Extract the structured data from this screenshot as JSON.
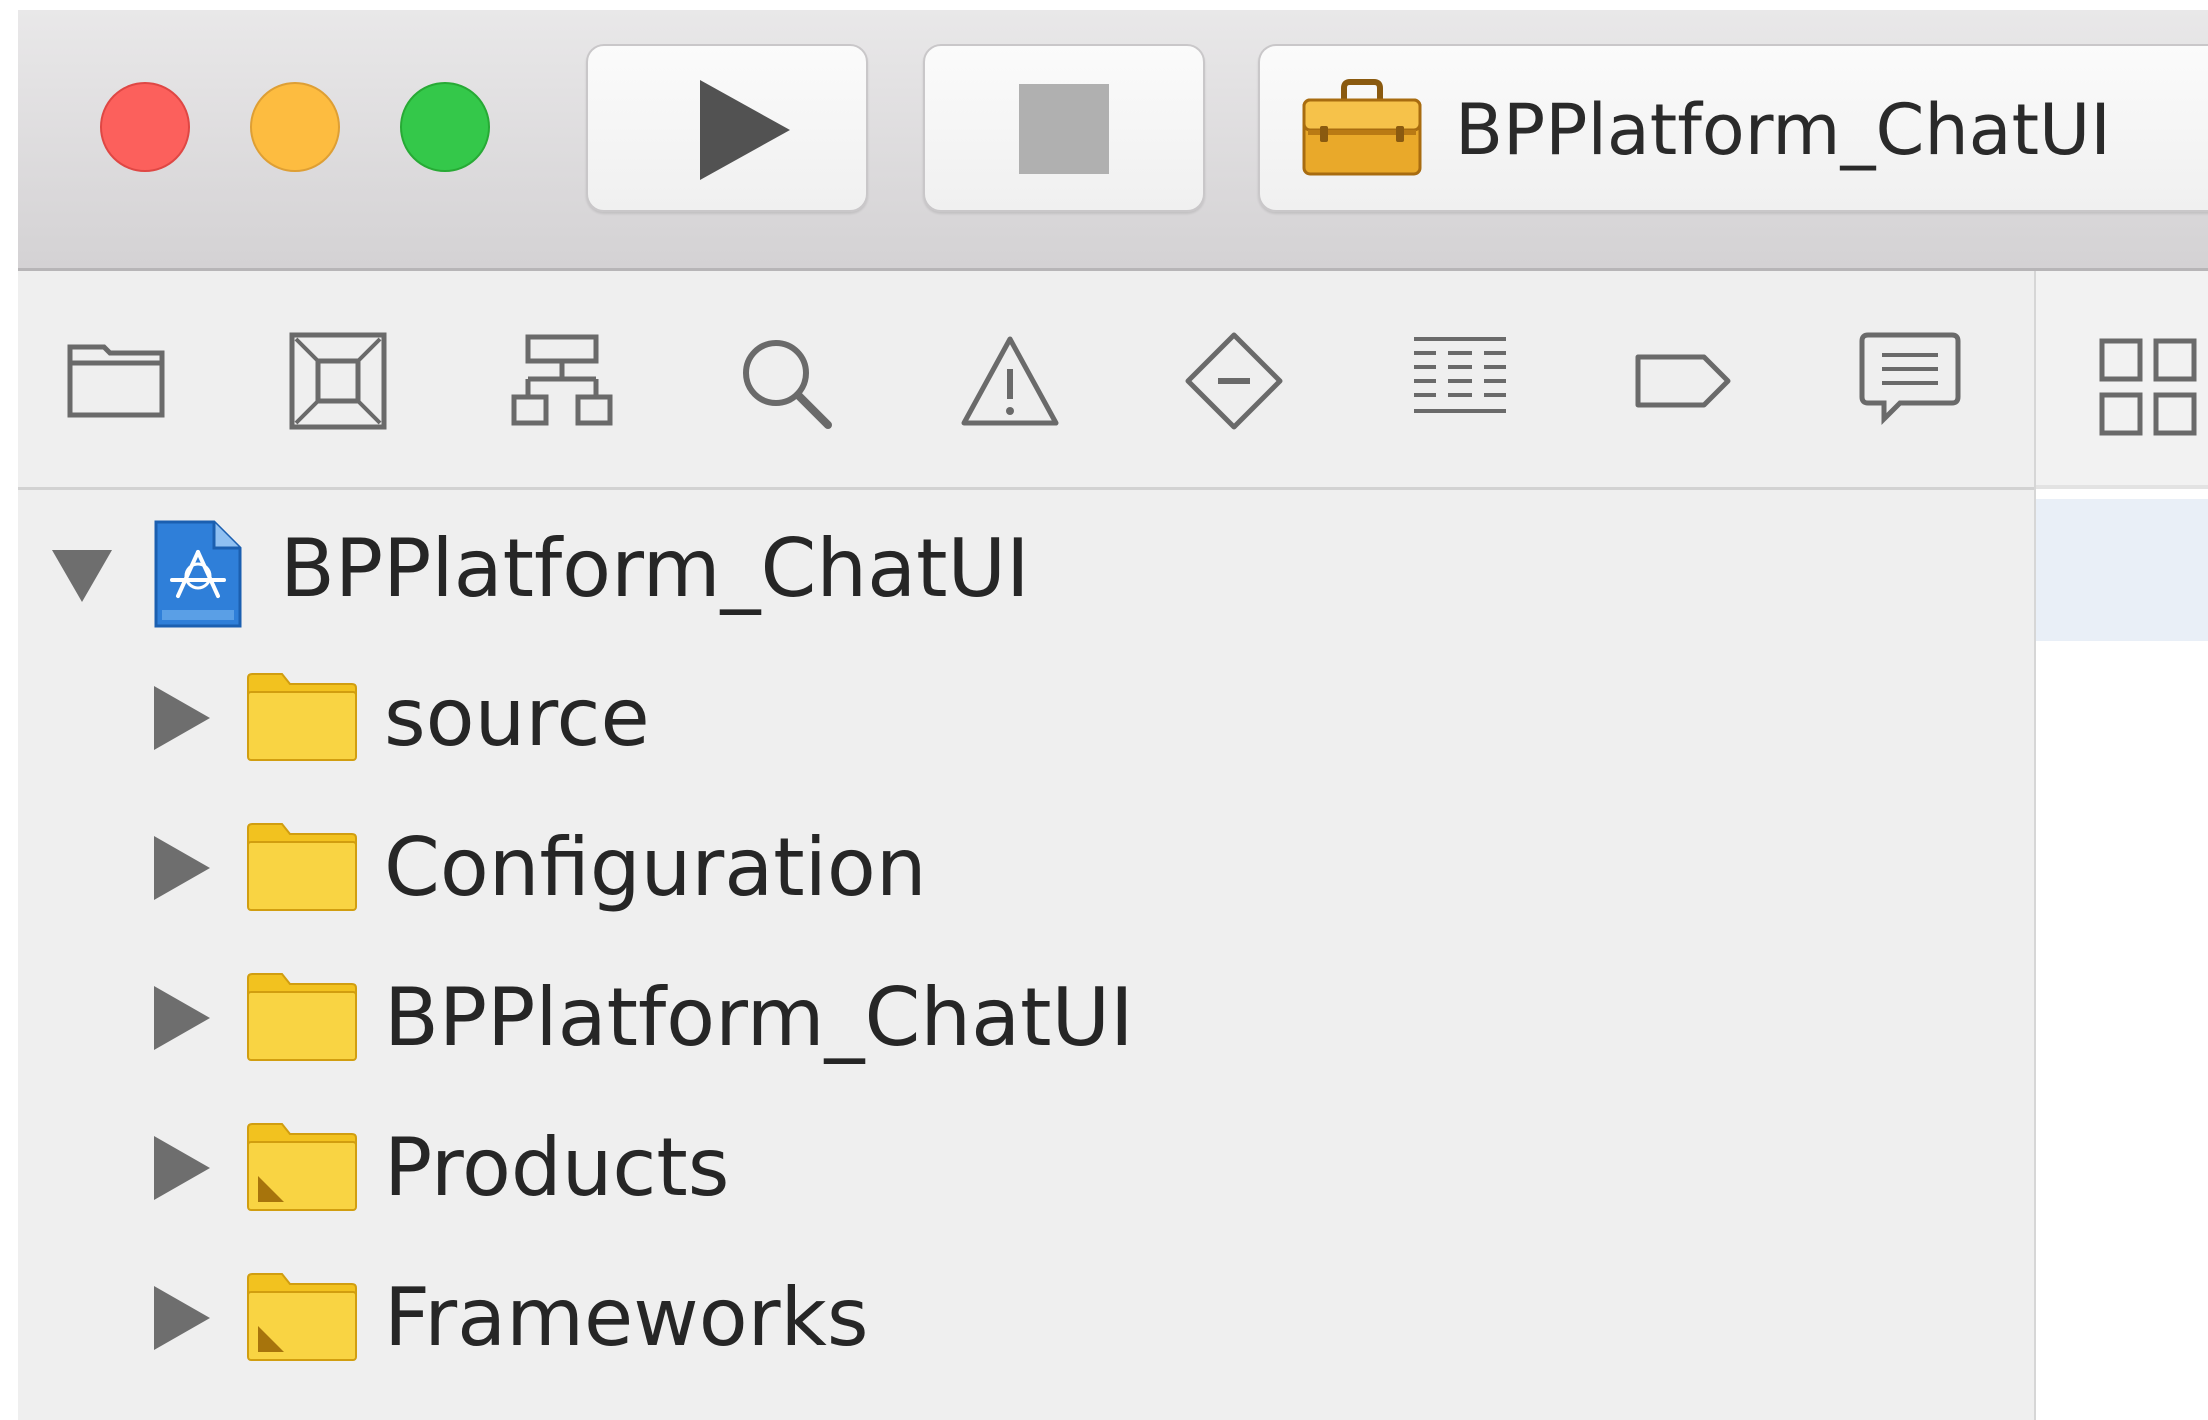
{
  "toolbar": {
    "window_controls": [
      "close",
      "minimize",
      "zoom"
    ],
    "run_icon": "play-icon",
    "stop_icon": "stop-icon",
    "scheme": {
      "icon": "toolbox-icon",
      "label": "BPPlatform_ChatUI"
    }
  },
  "navigator": {
    "icons": [
      "project-navigator-icon",
      "source-control-icon",
      "symbol-navigator-icon",
      "find-navigator-icon",
      "issue-navigator-icon",
      "test-navigator-icon",
      "debug-navigator-icon",
      "breakpoint-navigator-icon",
      "report-navigator-icon"
    ],
    "project": {
      "label": "BPPlatform_ChatUI",
      "icon": "xcode-project-icon",
      "expanded": true
    },
    "items": [
      {
        "label": "source",
        "icon": "folder-icon"
      },
      {
        "label": "Configuration",
        "icon": "folder-icon"
      },
      {
        "label": "BPPlatform_ChatUI",
        "icon": "folder-icon"
      },
      {
        "label": "Products",
        "icon": "products-folder-icon"
      },
      {
        "label": "Frameworks",
        "icon": "frameworks-folder-icon"
      }
    ]
  },
  "editor": {
    "jump_bar_icon": "related-items-grid-icon"
  },
  "colors": {
    "close": "#fc605c",
    "minimize": "#fdbc40",
    "zoom": "#34c84a",
    "folder": "#f5ca2c",
    "project_blue": "#2f7fd9",
    "selection": "#e9eff7"
  }
}
